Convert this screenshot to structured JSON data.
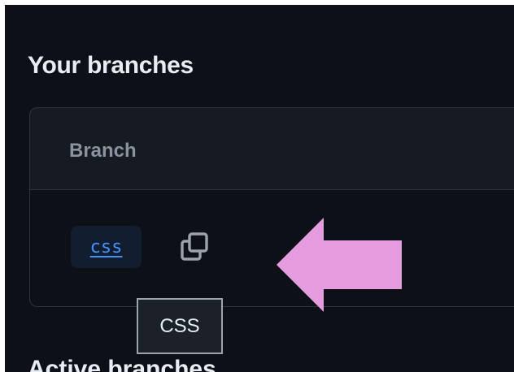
{
  "section_title": "Your branches",
  "table": {
    "column_header": "Branch",
    "row": {
      "branch_name": "css",
      "copy_icon": "copy-icon"
    }
  },
  "tooltip": {
    "text": "CSS"
  },
  "next_section_title": "Active branches",
  "annotation": {
    "arrow_color": "#e59ddf",
    "arrow_direction": "left"
  },
  "colors": {
    "background": "#0d1117",
    "panel": "#161b22",
    "border": "#30363d",
    "link": "#4493f8",
    "text": "#e6edf3",
    "muted": "#8b949e"
  }
}
